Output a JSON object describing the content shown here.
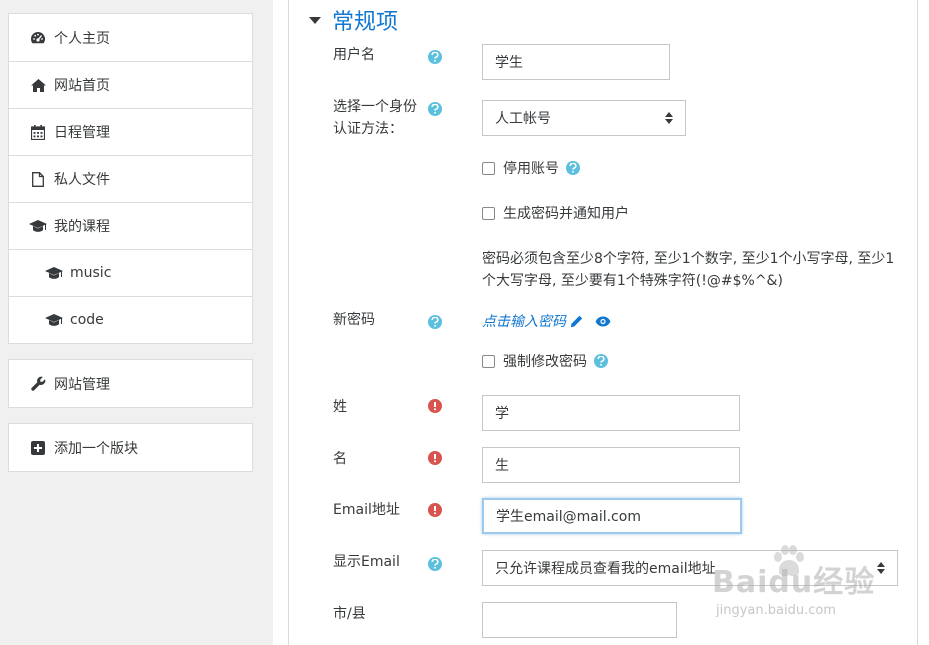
{
  "sidebar": {
    "items": [
      {
        "label": "个人主页",
        "icon": "dashboard-icon"
      },
      {
        "label": "网站首页",
        "icon": "home-icon"
      },
      {
        "label": "日程管理",
        "icon": "calendar-icon"
      },
      {
        "label": "私人文件",
        "icon": "file-icon"
      },
      {
        "label": "我的课程",
        "icon": "graduation-cap-icon"
      },
      {
        "label": "music",
        "icon": "graduation-cap-icon"
      },
      {
        "label": "code",
        "icon": "graduation-cap-icon"
      }
    ],
    "admin": {
      "label": "网站管理",
      "icon": "wrench-icon"
    },
    "add_block": {
      "label": "添加一个版块",
      "icon": "plus-square-icon"
    }
  },
  "form": {
    "section_title": "常规项",
    "username": {
      "label": "用户名",
      "value": "学生"
    },
    "auth": {
      "label_line1": "选择一个身份",
      "label_line2": "认证方法：",
      "value": "人工帐号"
    },
    "suspend": {
      "label": "停用账号"
    },
    "generate_password": {
      "label": "生成密码并通知用户"
    },
    "password_policy": "密码必须包含至少8个字符, 至少1个数字, 至少1个小写字母, 至少1个大写字母, 至少要有1个特殊字符(!@#$%^&)",
    "new_password": {
      "label": "新密码",
      "link": "点击输入密码"
    },
    "force_change": {
      "label": "强制修改密码"
    },
    "firstname": {
      "label": "姓",
      "value": "学"
    },
    "lastname": {
      "label": "名",
      "value": "生"
    },
    "email": {
      "label": "Email地址",
      "value": "学生email@mail.com"
    },
    "display_email": {
      "label": "显示Email",
      "value": "只允许课程成员查看我的email地址"
    },
    "city": {
      "label": "市/县",
      "value": ""
    }
  },
  "watermark": {
    "brand": "Baidu经验",
    "url": "jingyan.baidu.com"
  },
  "colors": {
    "link": "#1177d1",
    "help": "#5bc0de",
    "required": "#d9534f",
    "focus": "#9ecaed"
  }
}
